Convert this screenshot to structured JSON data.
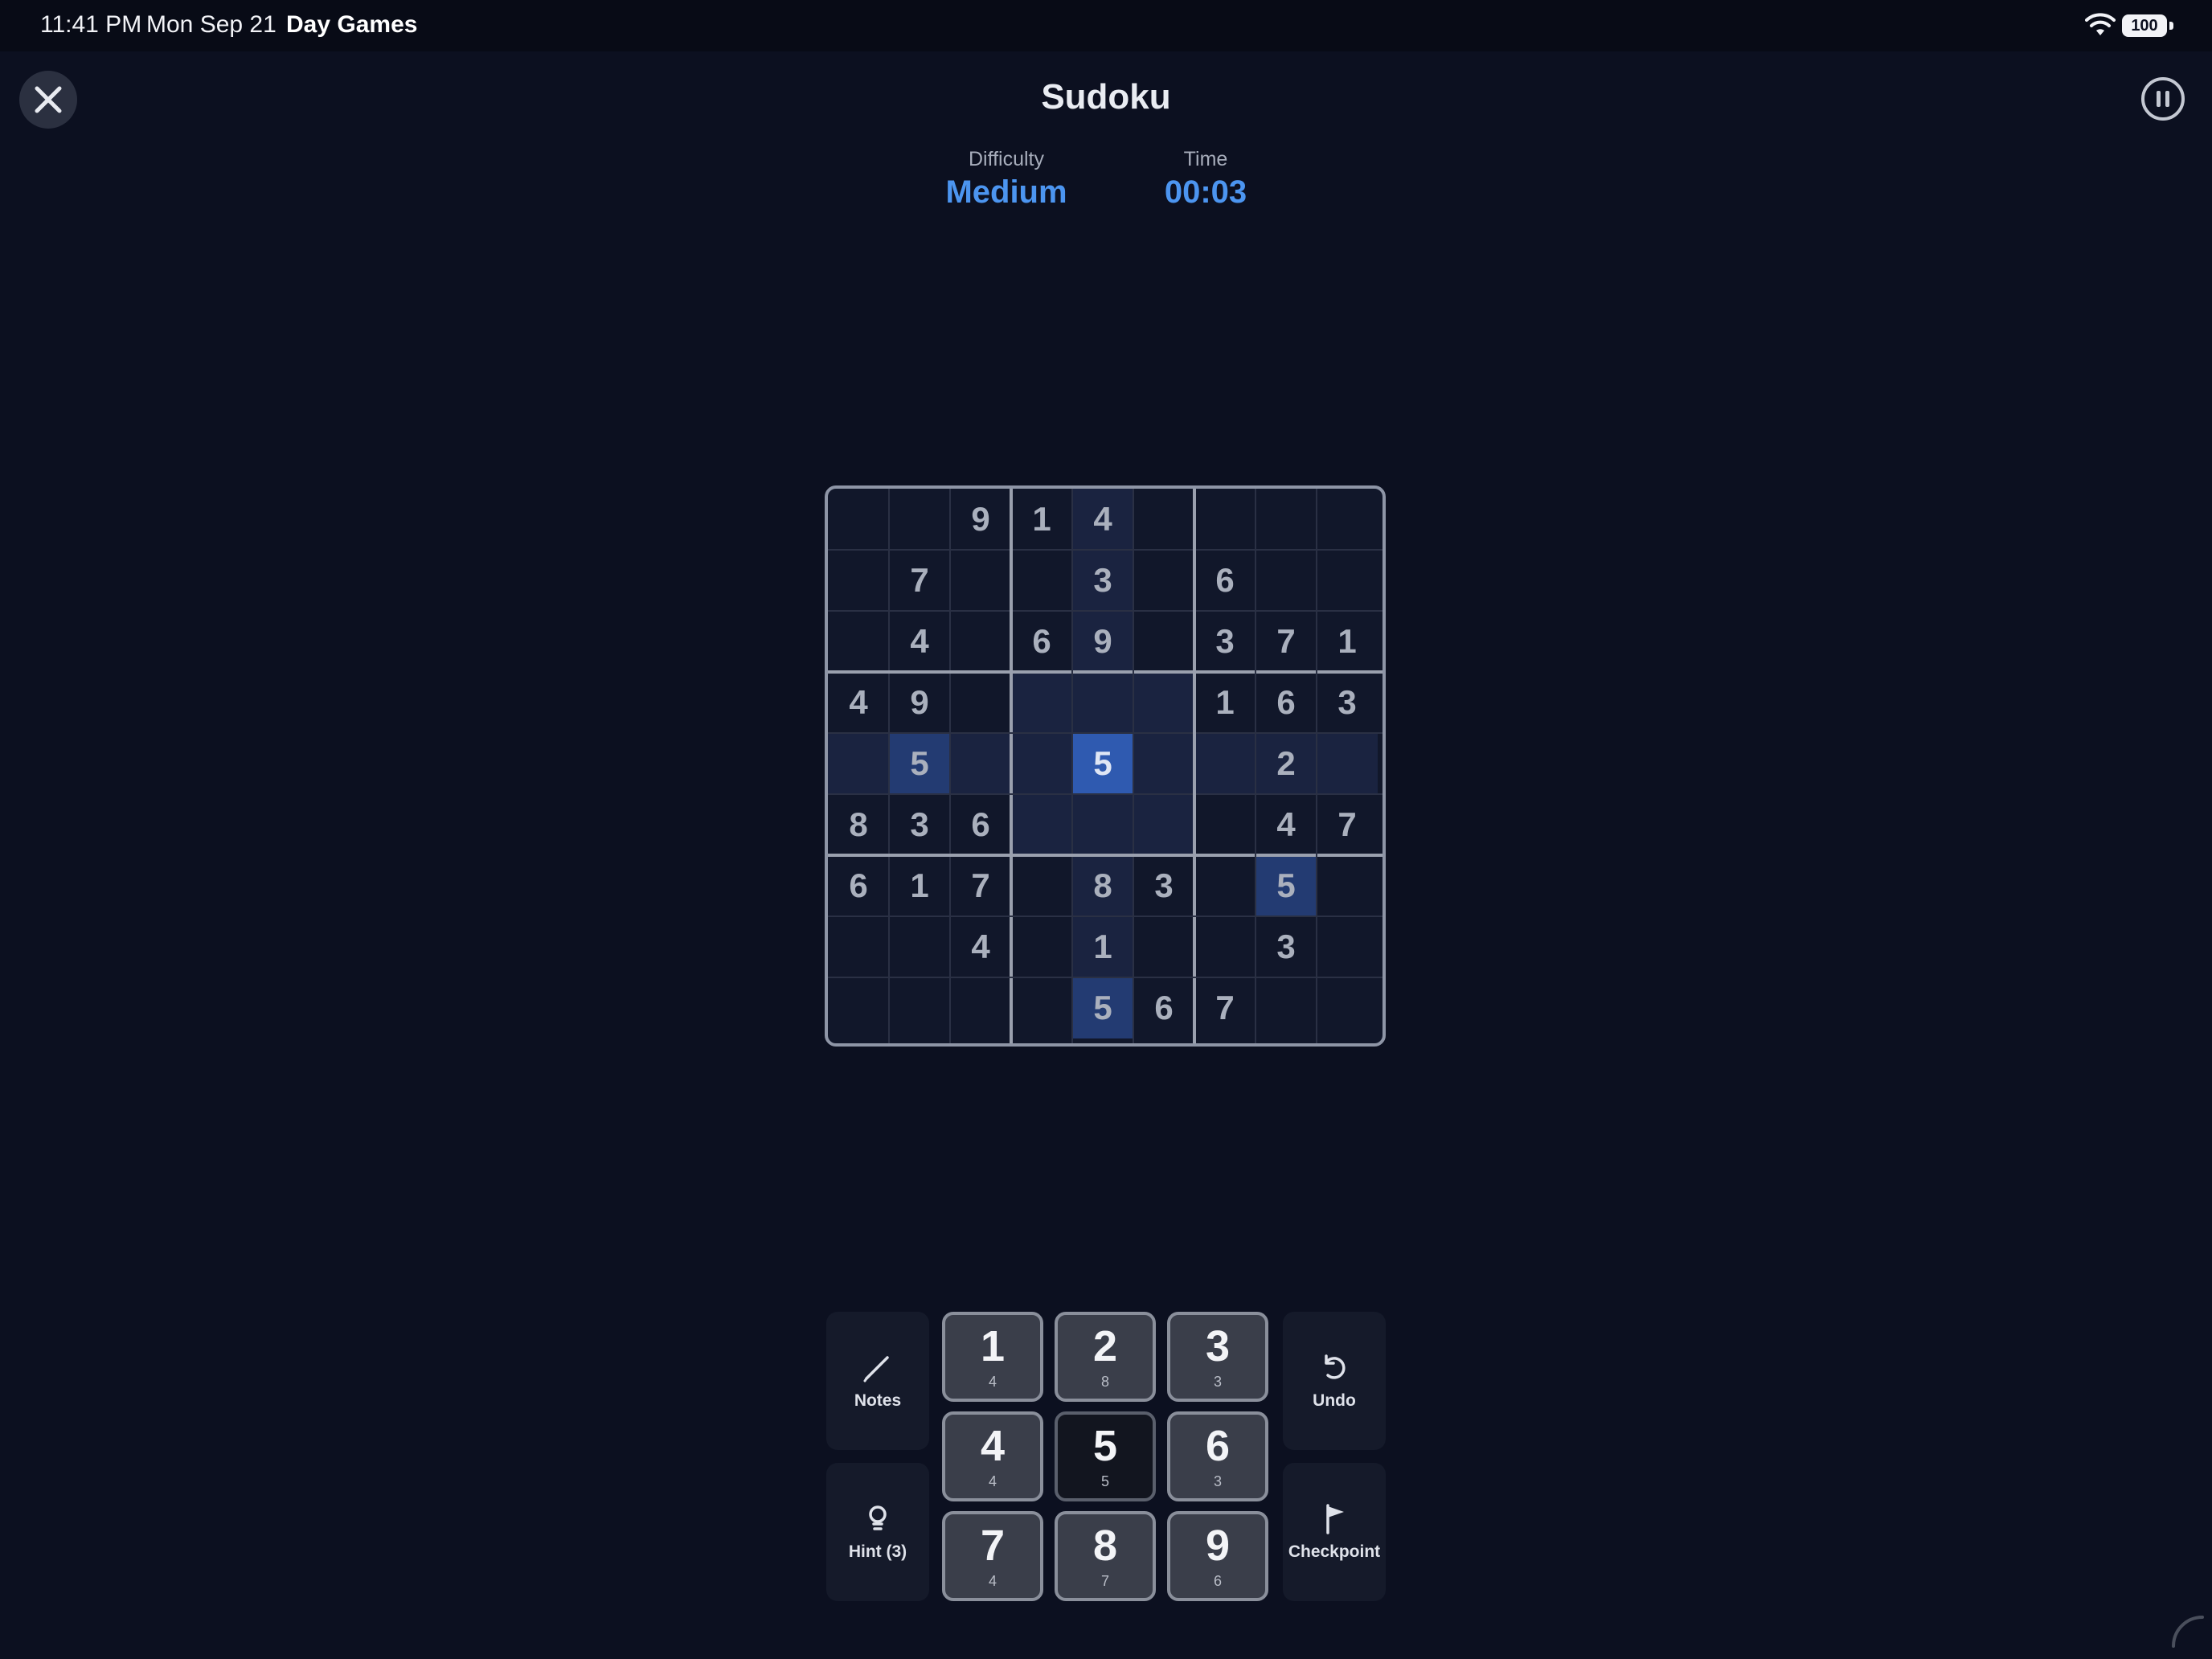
{
  "status_bar": {
    "time": "11:41 PM",
    "date": "Mon Sep 21",
    "app": "Day Games",
    "battery": "100"
  },
  "header": {
    "title": "Sudoku"
  },
  "stats": {
    "difficulty_label": "Difficulty",
    "difficulty_value": "Medium",
    "time_label": "Time",
    "time_value": "00:03"
  },
  "colors": {
    "accent": "#4c95f0",
    "background": "#0c1020",
    "selected_cell": "#2f5ab0"
  },
  "board": {
    "grid": [
      [
        "",
        "",
        "9",
        "1",
        "4",
        "",
        "",
        "",
        ""
      ],
      [
        "",
        "7",
        "",
        "",
        "3",
        "",
        "6",
        "",
        ""
      ],
      [
        "",
        "4",
        "",
        "6",
        "9",
        "",
        "3",
        "7",
        "1"
      ],
      [
        "4",
        "9",
        "",
        "",
        "",
        "",
        "1",
        "6",
        "3"
      ],
      [
        "",
        "5",
        "",
        "",
        "5",
        "",
        "",
        "2",
        ""
      ],
      [
        "8",
        "3",
        "6",
        "",
        "",
        "",
        "",
        "4",
        "7"
      ],
      [
        "6",
        "1",
        "7",
        "",
        "8",
        "3",
        "",
        "5",
        ""
      ],
      [
        "",
        "",
        "4",
        "",
        "1",
        "",
        "",
        "3",
        ""
      ],
      [
        "",
        "",
        "",
        "",
        "5",
        "6",
        "7",
        "",
        ""
      ]
    ],
    "selected_cell": {
      "row": 5,
      "col": 5
    },
    "highlighted_value": "5"
  },
  "tools": {
    "notes": {
      "label": "Notes",
      "icon": "pencil-icon"
    },
    "hint": {
      "label": "Hint (3)",
      "icon": "lightbulb-icon"
    },
    "undo": {
      "label": "Undo",
      "icon": "undo-icon"
    },
    "checkpoint": {
      "label": "Checkpoint",
      "icon": "flag-icon"
    }
  },
  "keypad": [
    {
      "num": "1",
      "count": "4"
    },
    {
      "num": "2",
      "count": "8"
    },
    {
      "num": "3",
      "count": "3"
    },
    {
      "num": "4",
      "count": "4"
    },
    {
      "num": "5",
      "count": "5",
      "active": true
    },
    {
      "num": "6",
      "count": "3"
    },
    {
      "num": "7",
      "count": "4"
    },
    {
      "num": "8",
      "count": "7"
    },
    {
      "num": "9",
      "count": "6"
    }
  ]
}
